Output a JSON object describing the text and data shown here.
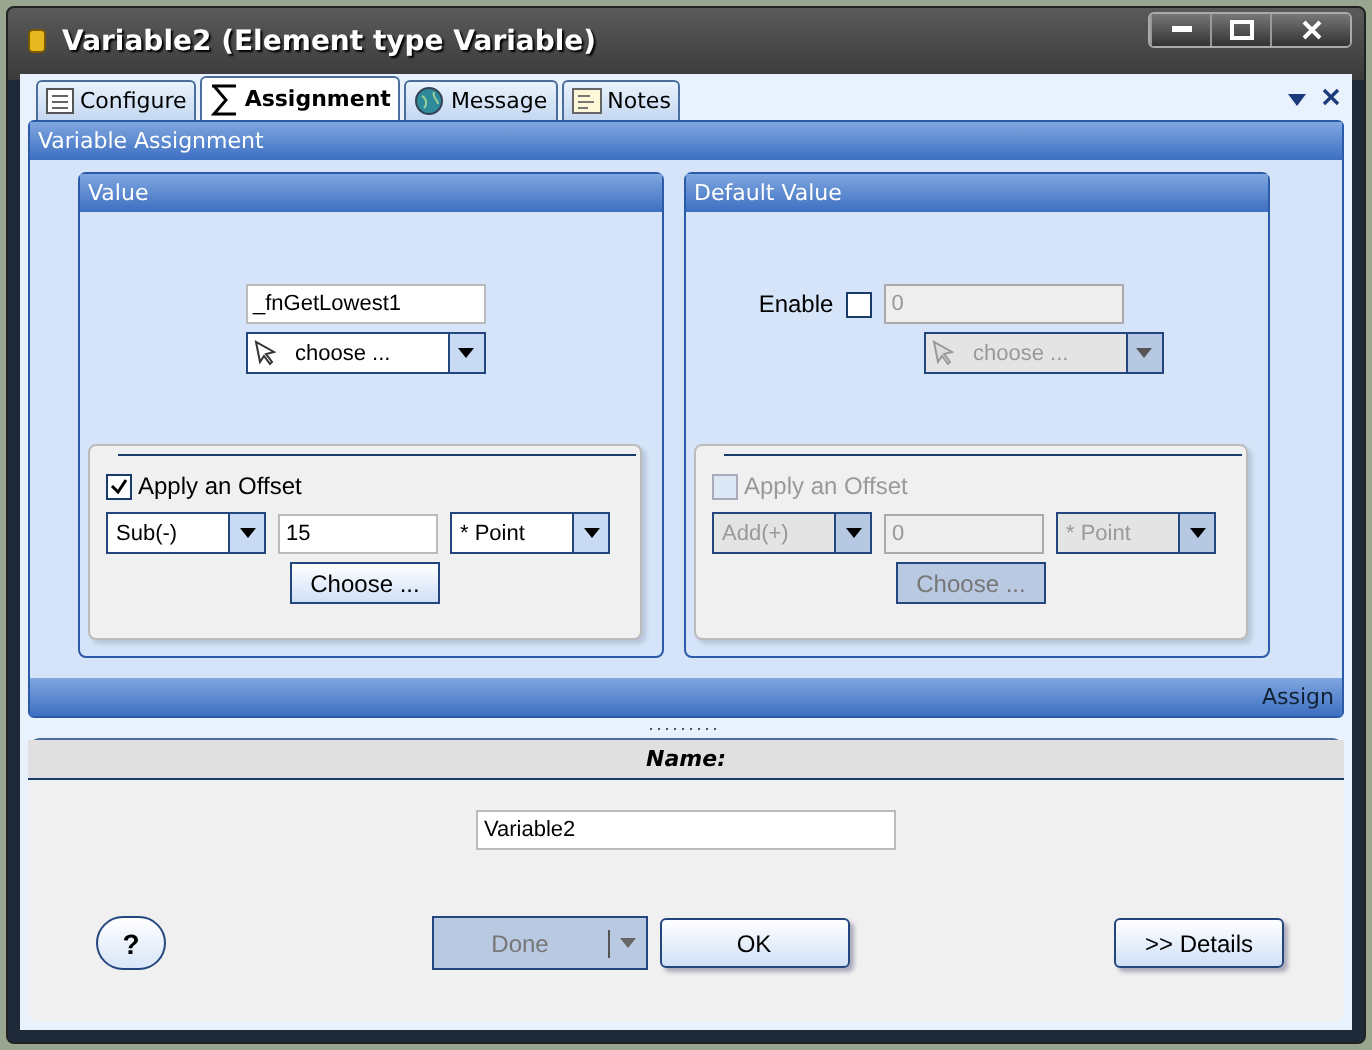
{
  "window": {
    "title": "Variable2 (Element type Variable)"
  },
  "tabs": [
    {
      "label": "Configure",
      "selected": false
    },
    {
      "label": "Assignment",
      "selected": true
    },
    {
      "label": "Message",
      "selected": false
    },
    {
      "label": "Notes",
      "selected": false
    }
  ],
  "section_title": "Variable Assignment",
  "panels": [
    {
      "title": "Value",
      "disabled": false,
      "value": "_fnGetLowest1",
      "chooser": "choose ...",
      "offset": {
        "label": "Apply an Offset",
        "checked": true,
        "operator": "Sub(-)",
        "amount": "15",
        "unit": "* Point",
        "button": "Choose ..."
      }
    },
    {
      "title": "Default Value",
      "disabled": true,
      "enable": {
        "label": "Enable",
        "checked": false
      },
      "value": "0",
      "chooser": "choose ...",
      "offset": {
        "label": "Apply an Offset",
        "checked": false,
        "operator": "Add(+)",
        "amount": "0",
        "unit": "* Point",
        "button": "Choose ..."
      }
    }
  ],
  "footer": "Assign",
  "name_section": {
    "label": "Name:",
    "value": "Variable2"
  },
  "buttons": {
    "help": "?",
    "done": {
      "label": "Done",
      "disabled": true
    },
    "ok": "OK",
    "details": ">> Details"
  }
}
